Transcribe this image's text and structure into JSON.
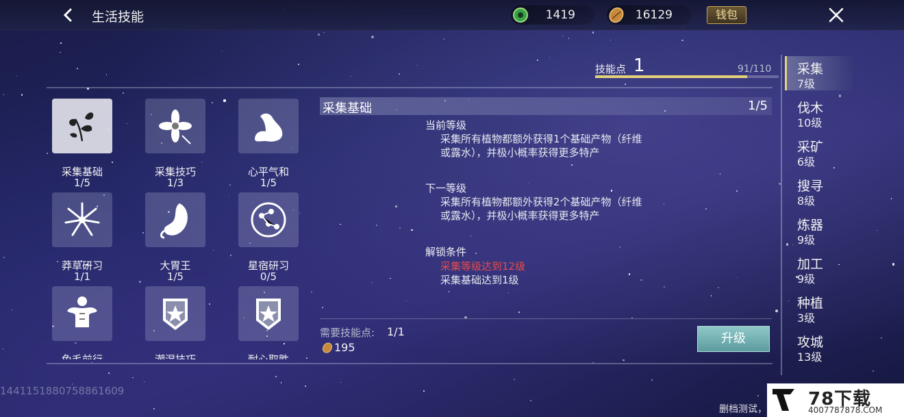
{
  "header": {
    "title": "生活技能",
    "currency1_value": "1419",
    "currency2_value": "16129",
    "wallet_label": "钱包"
  },
  "skill_points": {
    "label": "技能点",
    "value": "1",
    "progress_text": "91/110",
    "progress_fraction": 0.827
  },
  "skills": [
    {
      "name": "采集基础",
      "level": "1/5",
      "icon": "herb-leaves-icon",
      "selected": true
    },
    {
      "name": "采集技巧",
      "level": "1/3",
      "icon": "flower-icon"
    },
    {
      "name": "心平气和",
      "level": "1/5",
      "icon": "flexed-arm-icon"
    },
    {
      "name": "莽草研习",
      "level": "1/1",
      "icon": "grass-burst-icon"
    },
    {
      "name": "大胃王",
      "level": "1/5",
      "icon": "stomach-icon"
    },
    {
      "name": "星宿研习",
      "level": "0/5",
      "icon": "constellation-icon"
    },
    {
      "name": "兔毛前行",
      "level": "",
      "icon": "muscle-torso-icon"
    },
    {
      "name": "潮湿技巧",
      "level": "",
      "icon": "star-banner-icon"
    },
    {
      "name": "耐心取胜",
      "level": "",
      "icon": "star-banner-icon"
    }
  ],
  "detail": {
    "title": "采集基础",
    "level": "1/5",
    "current_heading": "当前等级",
    "current_text": "采集所有植物都额外获得1个基础产物（纤维或露水），并极小概率获得更多特产",
    "next_heading": "下一等级",
    "next_text": "采集所有植物都额外获得2个基础产物（纤维或露水），并极小概率获得更多特产",
    "unlock_heading": "解锁条件",
    "unlock_req1": "采集等级达到12级",
    "unlock_req2": "采集基础达到1级",
    "need_label": "需要技能点:",
    "need_value": "1/1",
    "cost_value": "195",
    "upgrade_label": "升级"
  },
  "tabs": [
    {
      "name": "采集",
      "level": "7级",
      "active": true
    },
    {
      "name": "伐木",
      "level": "10级"
    },
    {
      "name": "采矿",
      "level": "6级"
    },
    {
      "name": "搜寻",
      "level": "8级"
    },
    {
      "name": "炼器",
      "level": "9级"
    },
    {
      "name": "加工",
      "level": "9级"
    },
    {
      "name": "种植",
      "level": "3级"
    },
    {
      "name": "攻城",
      "level": "13级"
    }
  ],
  "footer": {
    "uid": "1441151880758861609",
    "note": "删档测试，",
    "watermark_big": "78下载",
    "watermark_small": "4007787878.COM"
  },
  "colors": {
    "accent_gold": "#e4d27a",
    "requirement_red": "#e84a4a",
    "upgrade_button": "#7bb5b7"
  }
}
